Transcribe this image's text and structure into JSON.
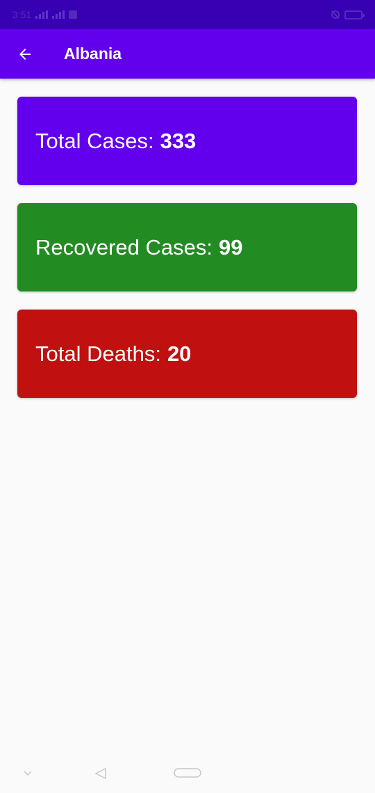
{
  "status_bar": {
    "time": "3:51"
  },
  "app_bar": {
    "title": "Albania",
    "back_icon": "arrow-left-icon"
  },
  "cards": [
    {
      "label": "Total Cases:",
      "value": "333",
      "color": "#6200ee"
    },
    {
      "label": "Recovered Cases:",
      "value": "99",
      "color": "#228b22"
    },
    {
      "label": "Total Deaths:",
      "value": "20",
      "color": "#c01010"
    }
  ],
  "colors": {
    "status_bar": "#3700b3",
    "app_bar": "#6200ee",
    "background": "#fafafa"
  },
  "nav_bar": {
    "icons": [
      "chevron-down-icon",
      "back-triangle-icon",
      "home-pill-icon"
    ]
  }
}
